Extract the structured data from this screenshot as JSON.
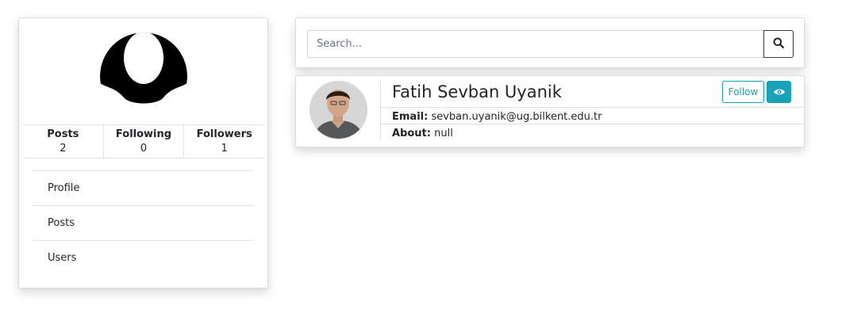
{
  "profile": {
    "stats": [
      {
        "label": "Posts",
        "value": "2"
      },
      {
        "label": "Following",
        "value": "0"
      },
      {
        "label": "Followers",
        "value": "1"
      }
    ],
    "menu": [
      {
        "label": "Profile"
      },
      {
        "label": "Posts"
      },
      {
        "label": "Users"
      }
    ]
  },
  "search": {
    "placeholder": "Search...",
    "button_icon": "search-icon"
  },
  "user_result": {
    "name": "Fatih Sevban Uyanik",
    "follow_label": "Follow",
    "view_icon": "eye-icon",
    "email_label": "Email:",
    "email": "sevban.uyanik@ug.bilkent.edu.tr",
    "about_label": "About:",
    "about": "null"
  },
  "colors": {
    "accent": "#17a2b8",
    "border": "#dee2e6",
    "text": "#212529"
  }
}
